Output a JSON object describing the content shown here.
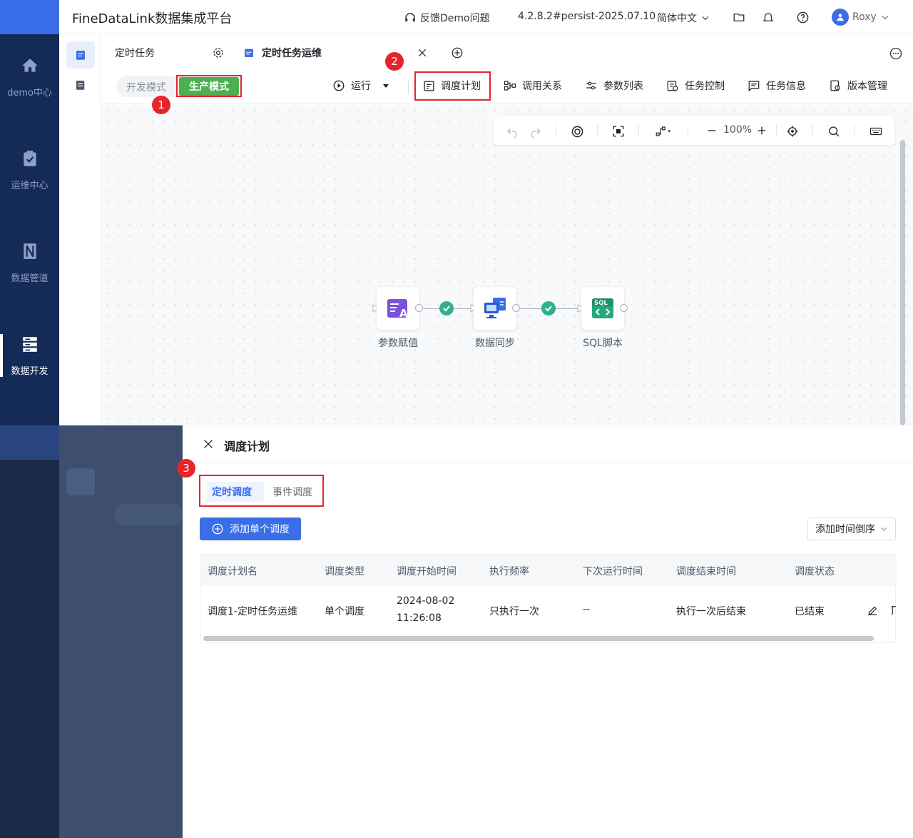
{
  "app": {
    "title": "FineDataLink数据集成平台",
    "feedback": "反馈Demo问题",
    "version": "4.2.8.2#persist-2025.07.10",
    "language": "简体中文",
    "user": "Roxy"
  },
  "sidebar": {
    "items": [
      {
        "label": "demo中心",
        "icon": "home-icon"
      },
      {
        "label": "运维中心",
        "icon": "clipboard-check-icon"
      },
      {
        "label": "数据管道",
        "icon": "pipeline-icon"
      },
      {
        "label": "数据开发",
        "icon": "server-stack-icon",
        "active": true
      }
    ]
  },
  "tabs": [
    {
      "label": "定时任务"
    },
    {
      "label": "定时任务运维"
    }
  ],
  "mode": {
    "dev": "开发模式",
    "prod": "生产模式"
  },
  "toolbar": {
    "run": "运行",
    "schedule": "调度计划",
    "call_relation": "调用关系",
    "param_list": "参数列表",
    "task_control": "任务控制",
    "task_info": "任务信息",
    "version_mgmt": "版本管理"
  },
  "canvas": {
    "zoom": "100%"
  },
  "nodes": [
    {
      "label": "参数赋值"
    },
    {
      "label": "数据同步"
    },
    {
      "label": "SQL脚本"
    }
  ],
  "annotations": [
    "1",
    "2",
    "3"
  ],
  "drawer": {
    "title": "调度计划",
    "tabs": [
      "定时调度",
      "事件调度"
    ],
    "add_button": "添加单个调度",
    "sort": "添加时间倒序",
    "columns": [
      "调度计划名",
      "调度类型",
      "调度开始时间",
      "执行频率",
      "下次运行时间",
      "调度结束时间",
      "调度状态"
    ],
    "rows": [
      {
        "name": "调度1-定时任务运维",
        "type": "单个调度",
        "start_date": "2024-08-02",
        "start_time": "11:26:08",
        "frequency": "只执行一次",
        "next_run": "--",
        "end": "执行一次后结束",
        "status": "已结束"
      }
    ]
  },
  "colors": {
    "accent": "#3a6ee8",
    "sidebar": "#142a57",
    "prod_mode": "#4caf50",
    "annotation": "#e5252a",
    "success": "#2fb18d"
  }
}
